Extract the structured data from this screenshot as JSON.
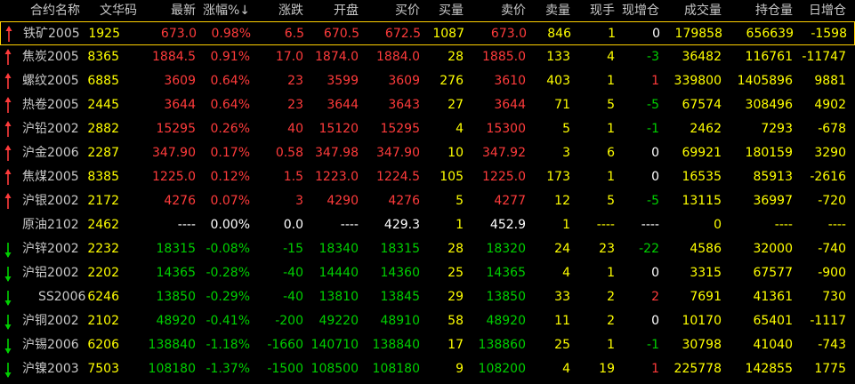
{
  "colors": {
    "up": "#ff3b3b",
    "down": "#00d000",
    "flat": "#ffffff",
    "yellow": "#ffff00",
    "header": "#c8c8c8",
    "name": "#c8c8c8",
    "select_border": "#ffd000"
  },
  "headers": [
    "合约名称",
    "文华码",
    "最新",
    "涨幅%↓",
    "涨跌",
    "开盘",
    "买价",
    "买量",
    "卖价",
    "卖量",
    "现手",
    "现增仓",
    "成交量",
    "持仓量",
    "日增仓"
  ],
  "rows": [
    {
      "arrow": "up",
      "name": "铁矿2005",
      "code": "1925",
      "last": "673.0",
      "pct": "0.98%",
      "chg": "6.5",
      "open": "670.5",
      "bid": "672.5",
      "bidvol": "1087",
      "ask": "673.0",
      "askvol": "846",
      "cur": "1",
      "curoi": "0",
      "vol": "179858",
      "oi": "656639",
      "dayoi": "-1598",
      "dir": "up",
      "curoi_dir": "flat",
      "selected": true
    },
    {
      "arrow": "up",
      "name": "焦炭2005",
      "code": "8365",
      "last": "1884.5",
      "pct": "0.91%",
      "chg": "17.0",
      "open": "1874.0",
      "bid": "1884.0",
      "bidvol": "28",
      "ask": "1885.0",
      "askvol": "133",
      "cur": "4",
      "curoi": "-3",
      "vol": "36482",
      "oi": "116761",
      "dayoi": "-11747",
      "dir": "up",
      "curoi_dir": "down"
    },
    {
      "arrow": "up",
      "name": "螺纹2005",
      "code": "6885",
      "last": "3609",
      "pct": "0.64%",
      "chg": "23",
      "open": "3599",
      "bid": "3609",
      "bidvol": "276",
      "ask": "3610",
      "askvol": "403",
      "cur": "1",
      "curoi": "1",
      "vol": "339800",
      "oi": "1405896",
      "dayoi": "9881",
      "dir": "up",
      "curoi_dir": "up"
    },
    {
      "arrow": "up",
      "name": "热卷2005",
      "code": "2445",
      "last": "3644",
      "pct": "0.64%",
      "chg": "23",
      "open": "3644",
      "bid": "3643",
      "bidvol": "27",
      "ask": "3644",
      "askvol": "71",
      "cur": "5",
      "curoi": "-5",
      "vol": "67574",
      "oi": "308496",
      "dayoi": "4902",
      "dir": "up",
      "curoi_dir": "down"
    },
    {
      "arrow": "up",
      "name": "沪铅2002",
      "code": "2882",
      "last": "15295",
      "pct": "0.26%",
      "chg": "40",
      "open": "15120",
      "bid": "15295",
      "bidvol": "4",
      "ask": "15300",
      "askvol": "5",
      "cur": "1",
      "curoi": "-1",
      "vol": "2462",
      "oi": "7293",
      "dayoi": "-678",
      "dir": "up",
      "curoi_dir": "down"
    },
    {
      "arrow": "up",
      "name": "沪金2006",
      "code": "2287",
      "last": "347.90",
      "pct": "0.17%",
      "chg": "0.58",
      "open": "347.98",
      "bid": "347.90",
      "bidvol": "10",
      "ask": "347.92",
      "askvol": "3",
      "cur": "6",
      "curoi": "0",
      "vol": "69921",
      "oi": "180159",
      "dayoi": "3290",
      "dir": "up",
      "curoi_dir": "flat"
    },
    {
      "arrow": "up",
      "name": "焦煤2005",
      "code": "8385",
      "last": "1225.0",
      "pct": "0.12%",
      "chg": "1.5",
      "open": "1223.0",
      "bid": "1224.5",
      "bidvol": "105",
      "ask": "1225.0",
      "askvol": "173",
      "cur": "1",
      "curoi": "0",
      "vol": "16535",
      "oi": "85913",
      "dayoi": "-2616",
      "dir": "up",
      "curoi_dir": "flat"
    },
    {
      "arrow": "up",
      "name": "沪银2002",
      "code": "2172",
      "last": "4276",
      "pct": "0.07%",
      "chg": "3",
      "open": "4290",
      "bid": "4276",
      "bidvol": "5",
      "ask": "4277",
      "askvol": "12",
      "cur": "5",
      "curoi": "-5",
      "vol": "13115",
      "oi": "36997",
      "dayoi": "-720",
      "dir": "up",
      "curoi_dir": "down"
    },
    {
      "arrow": "none",
      "name": "原油2102",
      "code": "2462",
      "last": "----",
      "pct": "0.00%",
      "chg": "0.0",
      "open": "----",
      "bid": "429.3",
      "bidvol": "1",
      "ask": "452.9",
      "askvol": "1",
      "cur": "----",
      "curoi": "----",
      "vol": "0",
      "oi": "----",
      "dayoi": "----",
      "dir": "flat",
      "curoi_dir": "flat"
    },
    {
      "arrow": "down",
      "name": "沪锌2002",
      "code": "2232",
      "last": "18315",
      "pct": "-0.08%",
      "chg": "-15",
      "open": "18340",
      "bid": "18315",
      "bidvol": "28",
      "ask": "18320",
      "askvol": "24",
      "cur": "23",
      "curoi": "-22",
      "vol": "4586",
      "oi": "32000",
      "dayoi": "-740",
      "dir": "down",
      "curoi_dir": "down"
    },
    {
      "arrow": "down",
      "name": "沪铝2002",
      "code": "2202",
      "last": "14365",
      "pct": "-0.28%",
      "chg": "-40",
      "open": "14440",
      "bid": "14360",
      "bidvol": "25",
      "ask": "14365",
      "askvol": "4",
      "cur": "1",
      "curoi": "0",
      "vol": "3315",
      "oi": "67577",
      "dayoi": "-900",
      "dir": "down",
      "curoi_dir": "flat"
    },
    {
      "arrow": "down",
      "name": "SS2006",
      "code": "6246",
      "last": "13850",
      "pct": "-0.29%",
      "chg": "-40",
      "open": "13810",
      "bid": "13845",
      "bidvol": "29",
      "ask": "13850",
      "askvol": "33",
      "cur": "2",
      "curoi": "2",
      "vol": "7691",
      "oi": "41361",
      "dayoi": "730",
      "dir": "down",
      "curoi_dir": "up"
    },
    {
      "arrow": "down",
      "name": "沪铜2002",
      "code": "2102",
      "last": "48920",
      "pct": "-0.41%",
      "chg": "-200",
      "open": "49220",
      "bid": "48910",
      "bidvol": "58",
      "ask": "48920",
      "askvol": "11",
      "cur": "2",
      "curoi": "0",
      "vol": "10170",
      "oi": "65401",
      "dayoi": "-1117",
      "dir": "down",
      "curoi_dir": "flat"
    },
    {
      "arrow": "down",
      "name": "沪锡2006",
      "code": "6206",
      "last": "138840",
      "pct": "-1.18%",
      "chg": "-1660",
      "open": "140710",
      "bid": "138840",
      "bidvol": "17",
      "ask": "138860",
      "askvol": "25",
      "cur": "1",
      "curoi": "-1",
      "vol": "30798",
      "oi": "41040",
      "dayoi": "-743",
      "dir": "down",
      "curoi_dir": "down"
    },
    {
      "arrow": "down",
      "name": "沪镍2003",
      "code": "7503",
      "last": "108180",
      "pct": "-1.37%",
      "chg": "-1500",
      "open": "108500",
      "bid": "108180",
      "bidvol": "9",
      "ask": "108200",
      "askvol": "4",
      "cur": "19",
      "curoi": "1",
      "vol": "225778",
      "oi": "142855",
      "dayoi": "1775",
      "dir": "down",
      "curoi_dir": "up"
    }
  ]
}
